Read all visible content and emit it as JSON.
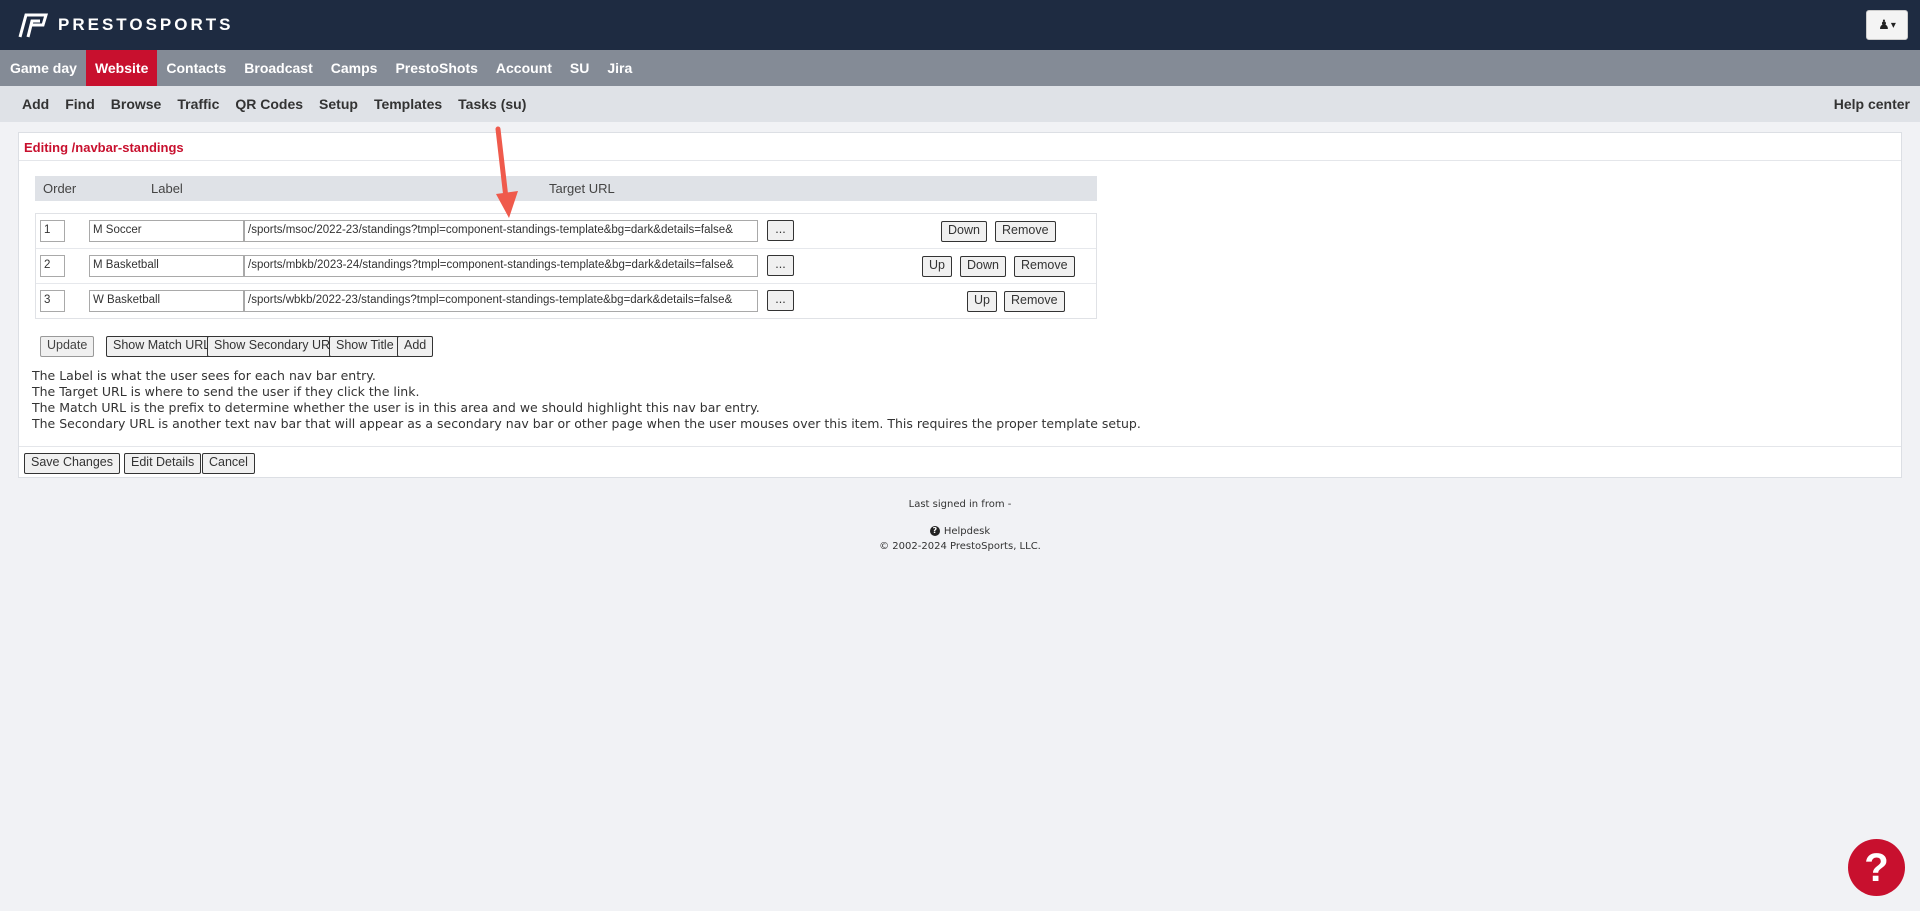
{
  "brand": {
    "name": "PRESTOSPORTS"
  },
  "user_menu": {
    "icon": "user-icon",
    "caret": "▾"
  },
  "main_nav": [
    {
      "label": "Game day"
    },
    {
      "label": "Website",
      "active": true
    },
    {
      "label": "Contacts"
    },
    {
      "label": "Broadcast"
    },
    {
      "label": "Camps"
    },
    {
      "label": "PrestoShots"
    },
    {
      "label": "Account"
    },
    {
      "label": "SU"
    },
    {
      "label": "Jira"
    }
  ],
  "sub_nav": {
    "items": [
      "Add",
      "Find",
      "Browse",
      "Traffic",
      "QR Codes",
      "Setup",
      "Templates",
      "Tasks (su)"
    ],
    "help": "Help center"
  },
  "editor": {
    "title": "Editing /navbar-standings",
    "columns": {
      "order": "Order",
      "label": "Label",
      "target_url": "Target URL"
    },
    "rows": [
      {
        "order": "1",
        "label": "M Soccer",
        "url": "/sports/msoc/2022-23/standings?tmpl=component-standings-template&bg=dark&details=false&",
        "more": "...",
        "down": "Down",
        "remove": "Remove"
      },
      {
        "order": "2",
        "label": "M Basketball",
        "url": "/sports/mbkb/2023-24/standings?tmpl=component-standings-template&bg=dark&details=false&",
        "more": "...",
        "up": "Up",
        "down": "Down",
        "remove": "Remove"
      },
      {
        "order": "3",
        "label": "W Basketball",
        "url": "/sports/wbkb/2022-23/standings?tmpl=component-standings-template&bg=dark&details=false&",
        "more": "...",
        "up": "Up",
        "remove": "Remove"
      }
    ],
    "actions": {
      "update": "Update",
      "show_match": "Show Match URL",
      "show_secondary": "Show Secondary URL",
      "show_title": "Show Title",
      "add": "Add"
    },
    "help_lines": [
      "The Label is what the user sees for each nav bar entry.",
      "The Target URL is where to send the user if they click the link.",
      "The Match URL is the prefix to determine whether the user is in this area and we should highlight this nav bar entry.",
      "The Secondary URL is another text nav bar that will appear as a secondary nav bar or other page when the user mouses over this item. This requires the proper template setup."
    ],
    "footer_buttons": {
      "save": "Save Changes",
      "edit_details": "Edit Details",
      "cancel": "Cancel"
    }
  },
  "footer": {
    "last_signed": "Last signed in from -",
    "helpdesk": "Helpdesk",
    "copyright": "© 2002-2024 PrestoSports, LLC."
  },
  "help_fab": {
    "label": "?"
  },
  "colors": {
    "brand_dark": "#1e2b41",
    "accent_red": "#c8102e",
    "nav_gray": "#848b96",
    "annotation_arrow": "#ef5a4c"
  }
}
